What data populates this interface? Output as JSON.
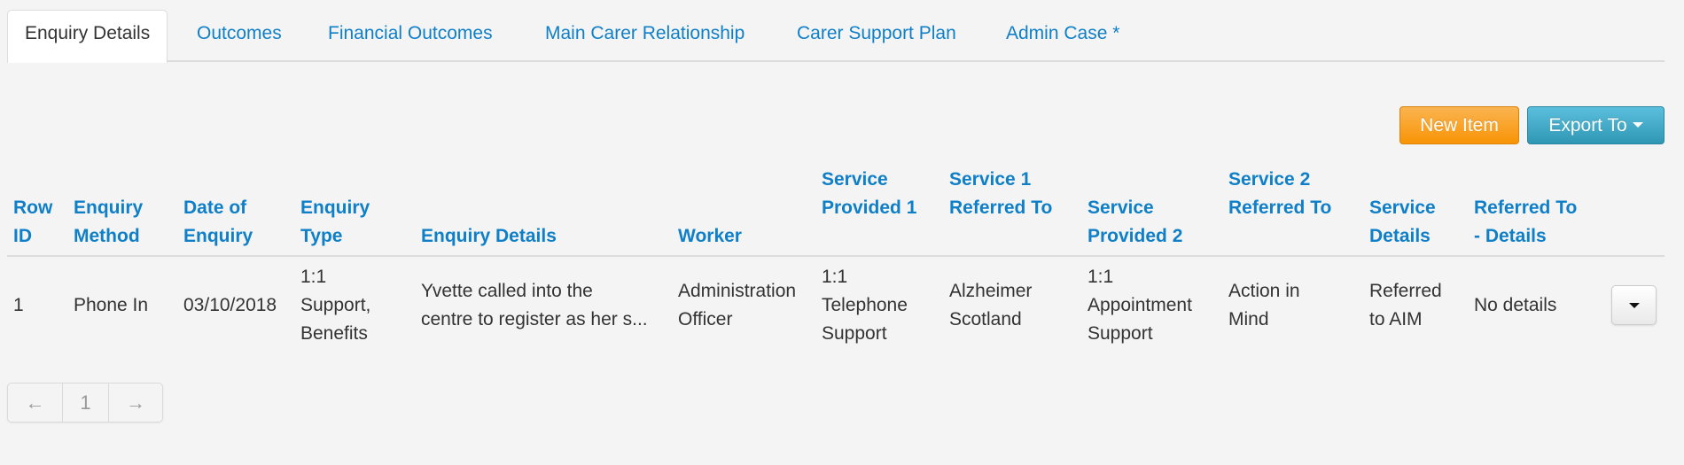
{
  "tabs": [
    {
      "label": "Enquiry Details",
      "active": true
    },
    {
      "label": "Outcomes",
      "active": false
    },
    {
      "label": "Financial Outcomes",
      "active": false
    },
    {
      "label": "Main Carer Relationship",
      "active": false
    },
    {
      "label": "Carer Support Plan",
      "active": false
    },
    {
      "label": "Admin Case *",
      "active": false
    }
  ],
  "toolbar": {
    "new_item_label": "New Item",
    "export_label": "Export To",
    "export_icon": "caret-down-icon"
  },
  "colors": {
    "link": "#0f7fc8",
    "new_item": "#f89406",
    "export": "#2f96b4",
    "background": "#f4f4f4"
  },
  "table": {
    "columns": [
      [
        "Row",
        "ID"
      ],
      [
        "Enquiry",
        "Method"
      ],
      [
        "Date of",
        "Enquiry"
      ],
      [
        "Enquiry",
        "Type"
      ],
      [
        "Enquiry Details"
      ],
      [
        "Worker"
      ],
      [
        "Service",
        "Provided 1"
      ],
      [
        "Service 1",
        "Referred To"
      ],
      [
        "Service",
        "Provided 2"
      ],
      [
        "Service 2",
        "Referred To"
      ],
      [
        "Service",
        "Details"
      ],
      [
        "Referred To",
        "- Details"
      ]
    ],
    "rows": [
      {
        "cells": [
          [
            "1"
          ],
          [
            "Phone In"
          ],
          [
            "03/10/2018"
          ],
          [
            "1:1",
            "Support,",
            "Benefits"
          ],
          [
            "Yvette called into the",
            "centre to register as her s..."
          ],
          [
            "Administration",
            "Officer"
          ],
          [
            "1:1",
            "Telephone",
            "Support"
          ],
          [
            "Alzheimer",
            "Scotland"
          ],
          [
            "1:1",
            "Appointment",
            "Support"
          ],
          [
            "Action in",
            "Mind"
          ],
          [
            "Referred",
            "to AIM"
          ],
          [
            "No details"
          ]
        ],
        "action_icon": "caret-down-icon"
      }
    ]
  },
  "pagination": {
    "prev": "←",
    "current": "1",
    "next": "→"
  }
}
